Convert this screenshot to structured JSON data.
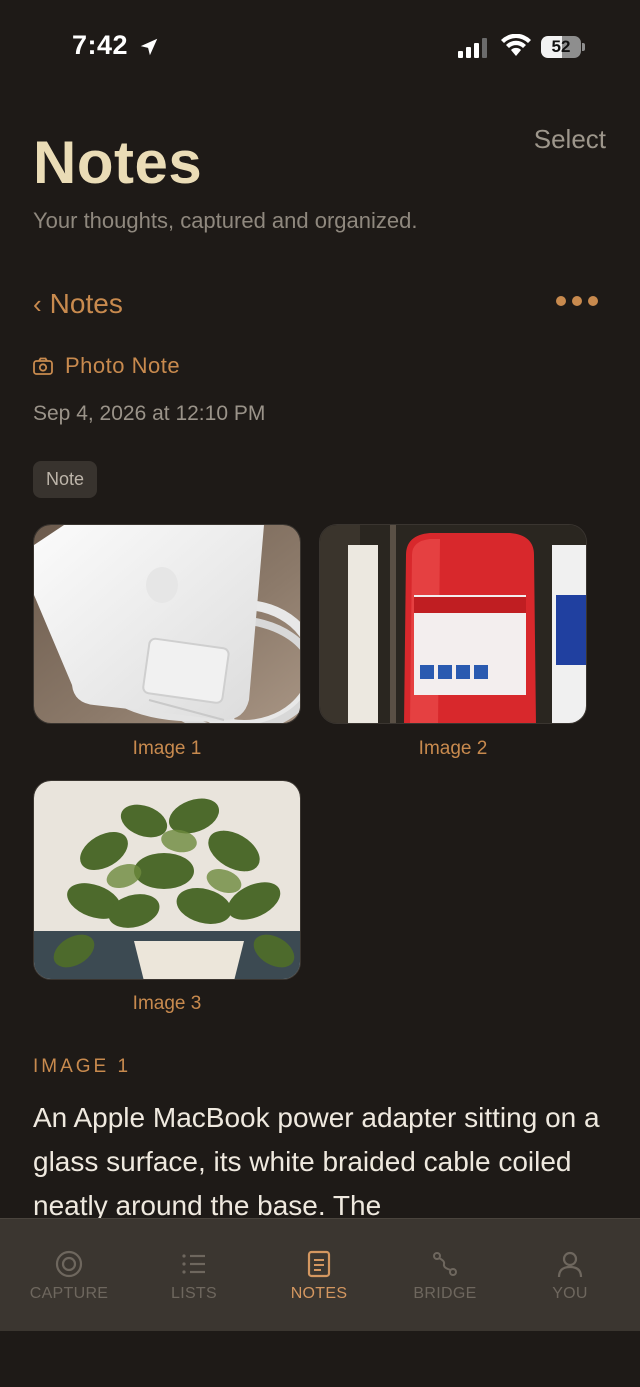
{
  "status_bar": {
    "time": "7:42",
    "battery": "52",
    "icons": [
      "location-arrow-icon",
      "signal-icon",
      "wifi-icon",
      "battery-icon"
    ]
  },
  "header": {
    "title": "Notes",
    "subtitle": "Your thoughts, captured and organized.",
    "select_label": "Select"
  },
  "nav": {
    "back_chevron": "‹",
    "back_label": "Notes",
    "more_icon": "ellipsis-icon"
  },
  "note": {
    "type_label": "Photo Note",
    "type_icon": "camera-icon",
    "date": "Sep 4, 2026 at 12:10 PM",
    "tag": "Note",
    "images": [
      {
        "caption": "Image 1",
        "subject": "power-adapter"
      },
      {
        "caption": "Image 2",
        "subject": "fire-extinguisher"
      },
      {
        "caption": "Image 3",
        "subject": "potted-plant"
      }
    ],
    "section_label": "IMAGE 1",
    "body": "An Apple MacBook power adapter sitting on a glass surface, its white braided cable coiled neatly around the base. The"
  },
  "tabs": [
    {
      "label": "CAPTURE",
      "icon": "capture-icon",
      "active": false
    },
    {
      "label": "LISTS",
      "icon": "list-icon",
      "active": false
    },
    {
      "label": "NOTES",
      "icon": "notes-icon",
      "active": true
    },
    {
      "label": "BRIDGE",
      "icon": "bridge-icon",
      "active": false
    },
    {
      "label": "YOU",
      "icon": "person-icon",
      "active": false
    }
  ],
  "colors": {
    "background": "#1e1a17",
    "accent": "#c88a4e",
    "title": "#eadcb6",
    "tab_bar": "#3b3630"
  }
}
